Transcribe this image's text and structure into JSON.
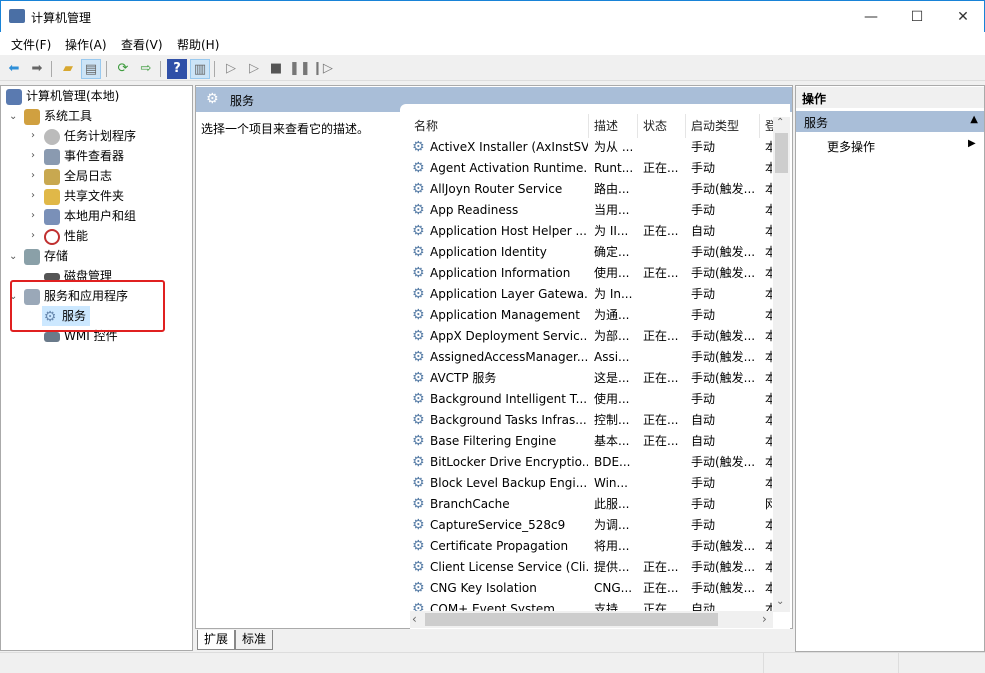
{
  "window": {
    "title": "计算机管理",
    "min": "—",
    "max": "☐",
    "close": "✕"
  },
  "menu": [
    "文件(F)",
    "操作(A)",
    "查看(V)",
    "帮助(H)"
  ],
  "toolbar": [
    "back",
    "forward",
    "up-folder",
    "show-hide-tree",
    "refresh",
    "export",
    "help",
    "show-hide-action",
    "start",
    "start-alt",
    "stop",
    "pause",
    "resume"
  ],
  "tree": {
    "root": "计算机管理(本地)",
    "system_tools": "系统工具",
    "system_children": [
      "任务计划程序",
      "事件查看器",
      "全局日志",
      "共享文件夹",
      "本地用户和组",
      "性能"
    ],
    "storage": "存储",
    "disk": "磁盘管理",
    "services_apps": "服务和应用程序",
    "services": "服务",
    "wmi": "WMI 控件"
  },
  "middle": {
    "title": "服务",
    "description": "选择一个项目来查看它的描述。",
    "columns": [
      "名称",
      "描述",
      "状态",
      "启动类型",
      "登"
    ],
    "rows": [
      [
        "ActiveX Installer (AxInstSV)",
        "为从 ...",
        "",
        "手动",
        "本"
      ],
      [
        "Agent Activation Runtime...",
        "Runt...",
        "正在...",
        "手动",
        "本"
      ],
      [
        "AllJoyn Router Service",
        "路由...",
        "",
        "手动(触发...",
        "本"
      ],
      [
        "App Readiness",
        "当用...",
        "",
        "手动",
        "本"
      ],
      [
        "Application Host Helper ...",
        "为 II...",
        "正在...",
        "自动",
        "本"
      ],
      [
        "Application Identity",
        "确定...",
        "",
        "手动(触发...",
        "本"
      ],
      [
        "Application Information",
        "使用...",
        "正在...",
        "手动(触发...",
        "本"
      ],
      [
        "Application Layer Gatewa...",
        "为 In...",
        "",
        "手动",
        "本"
      ],
      [
        "Application Management",
        "为通...",
        "",
        "手动",
        "本"
      ],
      [
        "AppX Deployment Servic...",
        "为部...",
        "正在...",
        "手动(触发...",
        "本"
      ],
      [
        "AssignedAccessManager...",
        "Assi...",
        "",
        "手动(触发...",
        "本"
      ],
      [
        "AVCTP 服务",
        "这是...",
        "正在...",
        "手动(触发...",
        "本"
      ],
      [
        "Background Intelligent T...",
        "使用...",
        "",
        "手动",
        "本"
      ],
      [
        "Background Tasks Infras...",
        "控制...",
        "正在...",
        "自动",
        "本"
      ],
      [
        "Base Filtering Engine",
        "基本...",
        "正在...",
        "自动",
        "本"
      ],
      [
        "BitLocker Drive Encryptio...",
        "BDE...",
        "",
        "手动(触发...",
        "本"
      ],
      [
        "Block Level Backup Engi...",
        "Win...",
        "",
        "手动",
        "本"
      ],
      [
        "BranchCache",
        "此服...",
        "",
        "手动",
        "网"
      ],
      [
        "CaptureService_528c9",
        "为调...",
        "",
        "手动",
        "本"
      ],
      [
        "Certificate Propagation",
        "将用...",
        "",
        "手动(触发...",
        "本"
      ],
      [
        "Client License Service (Cli...",
        "提供...",
        "正在...",
        "手动(触发...",
        "本"
      ],
      [
        "CNG Key Isolation",
        "CNG...",
        "正在...",
        "手动(触发...",
        "本"
      ],
      [
        "COM+ Event System",
        "支持...",
        "正在...",
        "自动",
        "本"
      ]
    ]
  },
  "tabs": [
    "扩展",
    "标准"
  ],
  "actions": {
    "header": "操作",
    "selected": "服务",
    "more": "更多操作"
  }
}
